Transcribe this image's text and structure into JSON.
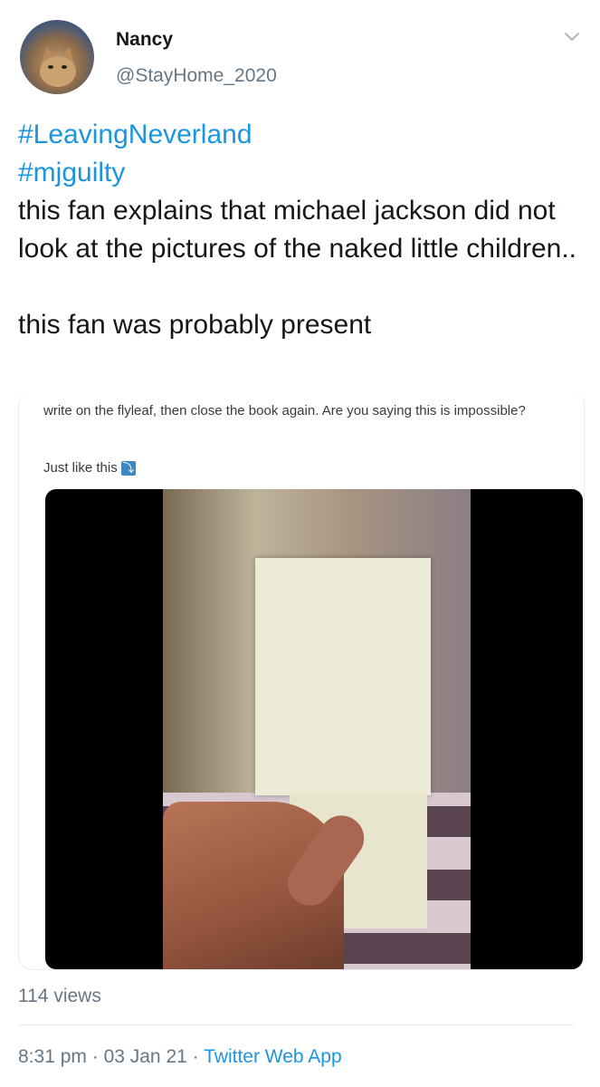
{
  "author": {
    "name": "Nancy",
    "handle": "@StayHome_2020"
  },
  "tweet": {
    "hashtags": [
      "#LeavingNeverland",
      "#mjguilty"
    ],
    "body": "this fan explains that michael jackson did not look at the pictures of the naked little children..\n\nthis fan was probably present"
  },
  "embed": {
    "text": "write on the flyleaf, then close the book again. Are you saying this is impossible?",
    "subtext": "Just like this",
    "emoji": "⤵"
  },
  "stats": {
    "views": "114 views"
  },
  "meta": {
    "time": "8:31 pm",
    "date": "03 Jan 21",
    "separator": " · ",
    "source": "Twitter Web App"
  },
  "icons": {
    "menu": "chevron-down-icon"
  },
  "colors": {
    "link": "#1b95e0",
    "secondary": "#657786",
    "text": "#14171a"
  }
}
